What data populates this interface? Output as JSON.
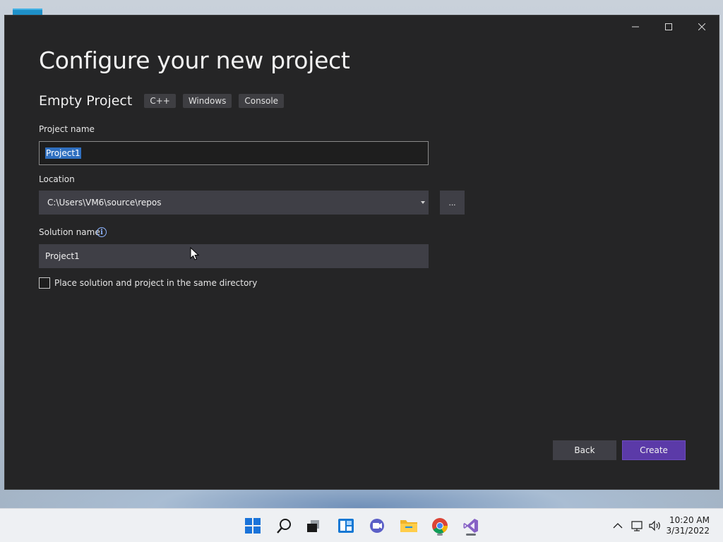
{
  "dialog": {
    "title": "Configure your new project",
    "template_name": "Empty Project",
    "tags": [
      "C++",
      "Windows",
      "Console"
    ],
    "project_name": {
      "label": "Project name",
      "value": "Project1"
    },
    "location": {
      "label": "Location",
      "value": "C:\\Users\\VM6\\source\\repos"
    },
    "browse_label": "...",
    "solution_name": {
      "label": "Solution name",
      "value": "Project1",
      "info_icon": "info-icon"
    },
    "same_dir_checkbox": {
      "label": "Place solution and project in the same directory",
      "checked": false
    },
    "back_label": "Back",
    "create_label": "Create"
  },
  "window_controls": [
    "minimize-icon",
    "maximize-icon",
    "close-icon"
  ],
  "taskbar": {
    "icons": [
      "start-icon",
      "search-icon",
      "task-view-icon",
      "widgets-icon",
      "chat-icon",
      "file-explorer-icon",
      "chrome-icon",
      "visual-studio-icon"
    ],
    "time": "10:20 AM",
    "date": "3/31/2022"
  },
  "colors": {
    "window_bg": "#252526",
    "accent_create": "#5b3aa8",
    "selection": "#2f6fbf"
  }
}
